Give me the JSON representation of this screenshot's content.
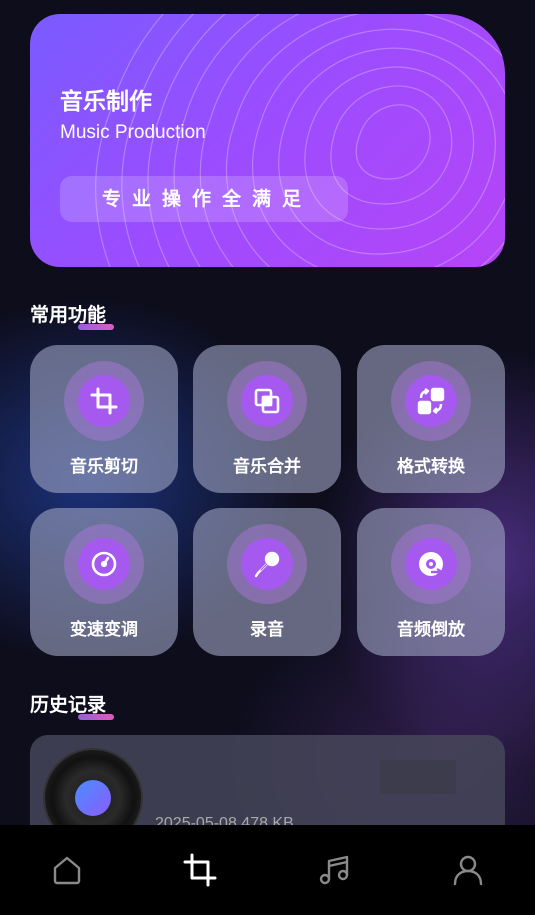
{
  "banner": {
    "title": "音乐制作",
    "subtitle": "Music Production",
    "slogan": "专业操作全满足"
  },
  "common": {
    "title": "常用功能",
    "items": [
      {
        "label": "音乐剪切",
        "icon": "crop-icon"
      },
      {
        "label": "音乐合并",
        "icon": "merge-icon"
      },
      {
        "label": "格式转换",
        "icon": "convert-icon"
      },
      {
        "label": "变速变调",
        "icon": "speed-dial-icon"
      },
      {
        "label": "录音",
        "icon": "microphone-icon"
      },
      {
        "label": "音频倒放",
        "icon": "reverse-disc-icon"
      }
    ]
  },
  "history": {
    "title": "历史记录",
    "items": [
      {
        "meta": "2025-05-08  478 KB"
      }
    ]
  },
  "nav": {
    "items": [
      {
        "icon": "home-icon"
      },
      {
        "icon": "crop-icon"
      },
      {
        "icon": "music-note-icon"
      },
      {
        "icon": "profile-icon"
      }
    ],
    "active_index": 1
  },
  "colors": {
    "accent": "#a659ee",
    "background": "#0d0d1c"
  }
}
